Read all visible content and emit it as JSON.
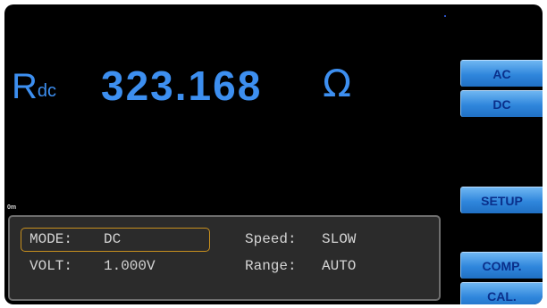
{
  "measurement": {
    "label_main": "R",
    "label_sub": "dc",
    "value": "323.168",
    "unit": "Ω"
  },
  "indicator_text": "0m",
  "softkeys": {
    "ac": "AC",
    "dc": "DC",
    "setup": "SETUP",
    "comp": "COMP.",
    "cal": "CAL."
  },
  "status": {
    "mode_label": "MODE:",
    "mode_value": "DC",
    "volt_label": "VOLT:",
    "volt_value": "1.000V",
    "speed_label": "Speed:",
    "speed_value": "SLOW",
    "range_label": "Range:",
    "range_value": "AUTO"
  },
  "colors": {
    "reading": "#3d8ff0",
    "softkey": "#2f86dc",
    "softkey_text": "#0a2f8a",
    "panel": "#2b2b2b",
    "mode_highlight": "#c8901e"
  }
}
